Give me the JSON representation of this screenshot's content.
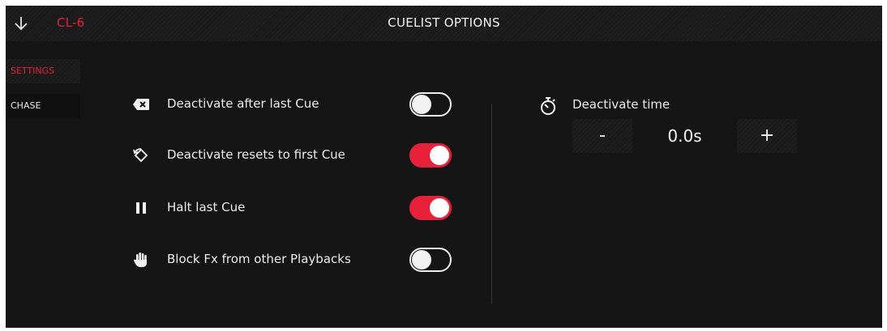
{
  "header": {
    "cuelist_name": "CL-6",
    "title": "CUELIST OPTIONS",
    "back_icon": "arrow-down-icon"
  },
  "sidebar": {
    "items": [
      {
        "label": "SETTINGS",
        "active": true
      },
      {
        "label": "CHASE",
        "active": false
      }
    ]
  },
  "options": [
    {
      "label": "Deactivate after last Cue",
      "icon": "deactivate-x-icon",
      "enabled": false
    },
    {
      "label": "Deactivate resets to first Cue",
      "icon": "reset-to-first-icon",
      "enabled": true
    },
    {
      "label": "Halt last Cue",
      "icon": "pause-icon",
      "enabled": true
    },
    {
      "label": "Block Fx from other Playbacks",
      "icon": "hand-block-icon",
      "enabled": false
    }
  ],
  "deactivate_time": {
    "label": "Deactivate time",
    "icon": "stopwatch-icon",
    "value": "0.0s",
    "decrement_label": "-",
    "increment_label": "+"
  },
  "colors": {
    "accent": "#e8203a",
    "background": "#151515",
    "text": "#ececec"
  }
}
